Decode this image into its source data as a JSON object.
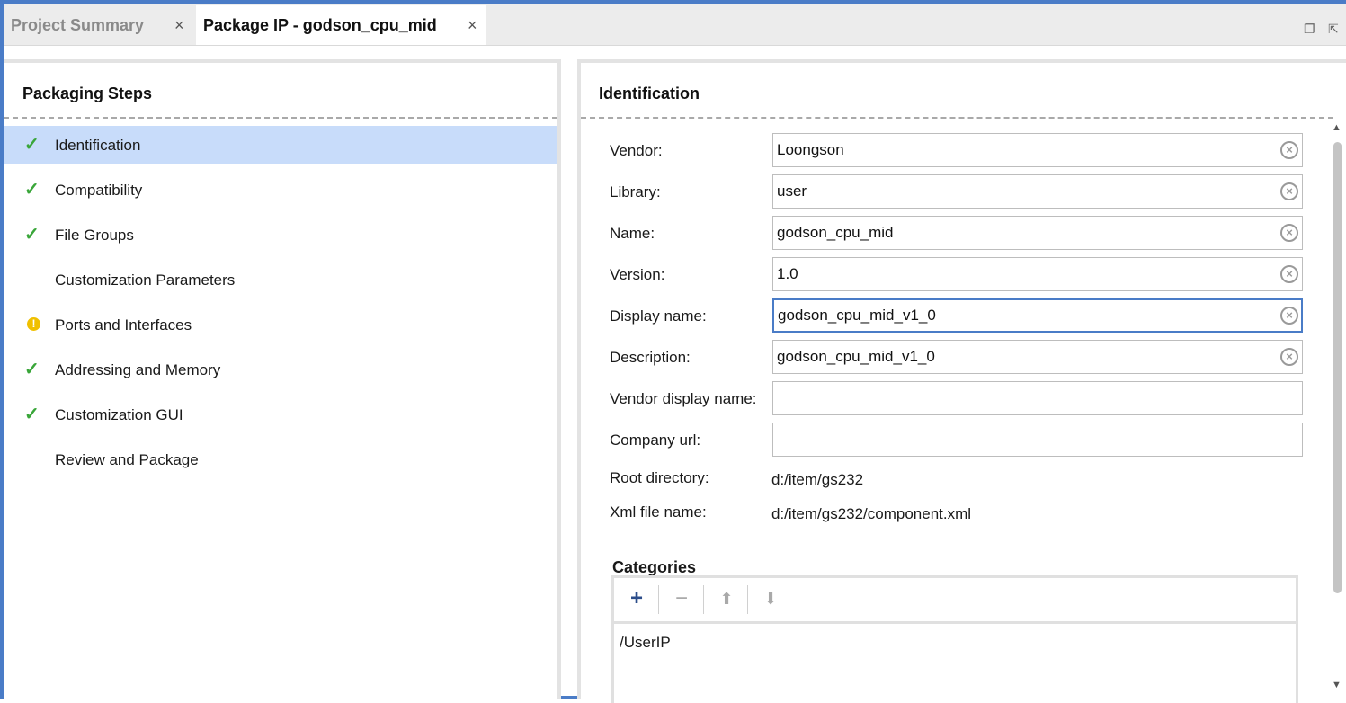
{
  "tabs": [
    {
      "label": "Project Summary",
      "active": false
    },
    {
      "label": "Package IP - godson_cpu_mid",
      "active": true
    }
  ],
  "tab_close_glyph": "×",
  "window_controls": {
    "restore_icon": "restore-window-icon",
    "float_icon": "float-window-icon"
  },
  "left": {
    "title": "Packaging Steps",
    "steps": [
      {
        "label": "Identification",
        "status": "done",
        "selected": true
      },
      {
        "label": "Compatibility",
        "status": "done"
      },
      {
        "label": "File Groups",
        "status": "done"
      },
      {
        "label": "Customization Parameters",
        "status": "none"
      },
      {
        "label": "Ports and Interfaces",
        "status": "warning"
      },
      {
        "label": "Addressing and Memory",
        "status": "done"
      },
      {
        "label": "Customization GUI",
        "status": "done"
      },
      {
        "label": "Review and Package",
        "status": "none"
      }
    ]
  },
  "right": {
    "title": "Identification",
    "fields": [
      {
        "label": "Vendor:",
        "value": "Loongson"
      },
      {
        "label": "Library:",
        "value": "user"
      },
      {
        "label": "Name:",
        "value": "godson_cpu_mid"
      },
      {
        "label": "Version:",
        "value": "1.0"
      },
      {
        "label": "Display name:",
        "value": "godson_cpu_mid_v1_0"
      },
      {
        "label": "Description:",
        "value": "godson_cpu_mid_v1_0"
      },
      {
        "label": "Vendor display name:",
        "value": ""
      },
      {
        "label": "Company url:",
        "value": ""
      }
    ],
    "info": [
      {
        "label": "Root directory:",
        "value": "d:/item/gs232"
      },
      {
        "label": "Xml file name:",
        "value": "d:/item/gs232/component.xml"
      }
    ],
    "categories": {
      "title": "Categories",
      "toolbar": [
        "+",
        "−",
        "⬆",
        "⬇"
      ],
      "items": [
        "/UserIP"
      ]
    }
  },
  "colors": {
    "accent": "#4a7cc7",
    "selection": "#c8dcfa",
    "check": "#3aa63a",
    "warning": "#f0c000"
  }
}
